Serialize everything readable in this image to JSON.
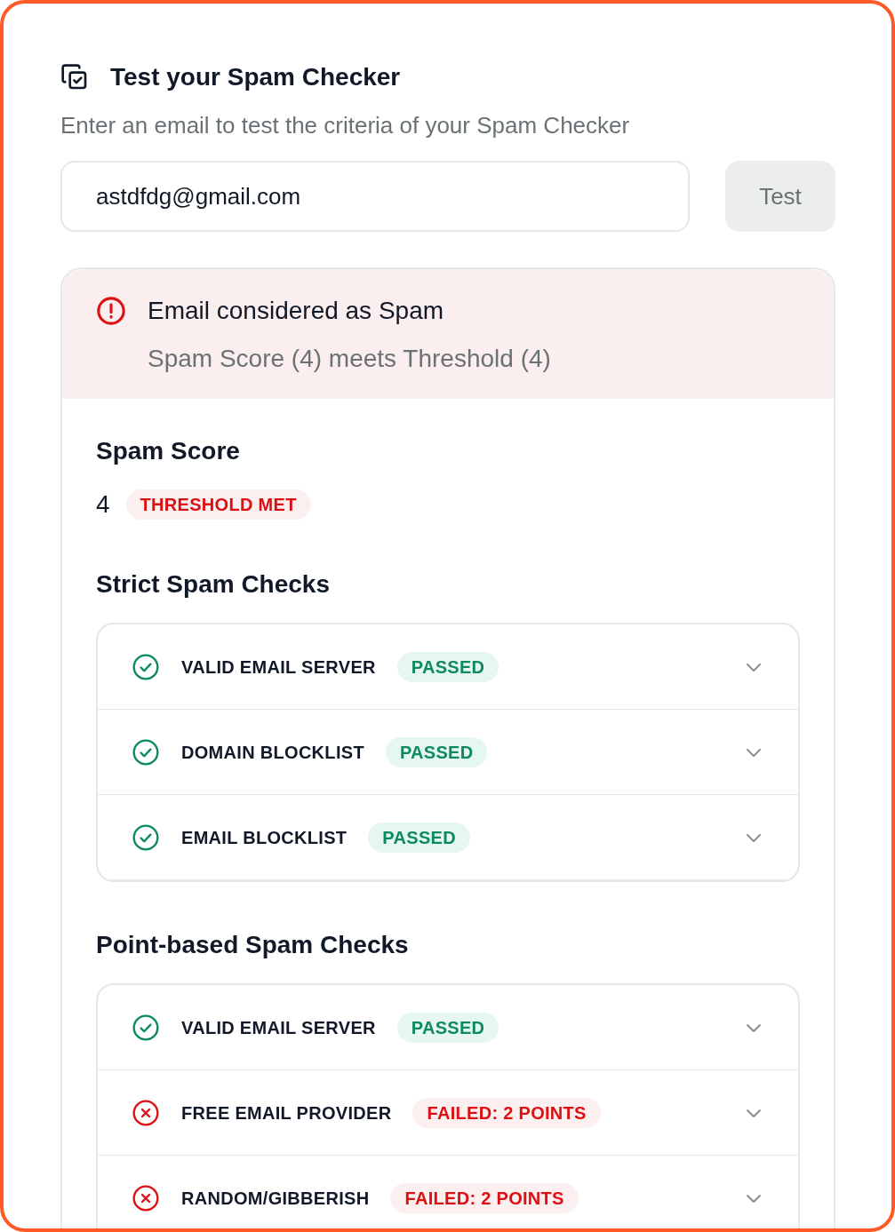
{
  "header": {
    "title": "Test your Spam Checker",
    "subtitle": "Enter an email to test the criteria of your Spam Checker"
  },
  "email_field": {
    "value": "astdfdg@gmail.com"
  },
  "test_button": {
    "label": "Test",
    "disabled": true
  },
  "result": {
    "kind": "spam",
    "title": "Email considered as Spam",
    "detail": "Spam Score (4) meets Threshold (4)"
  },
  "spam_score": {
    "heading": "Spam Score",
    "value": "4",
    "badge": "THRESHOLD MET"
  },
  "sections": [
    {
      "heading": "Strict Spam Checks",
      "checks": [
        {
          "label": "VALID EMAIL SERVER",
          "kind": "passed",
          "status": "PASSED"
        },
        {
          "label": "DOMAIN BLOCKLIST",
          "kind": "passed",
          "status": "PASSED"
        },
        {
          "label": "EMAIL BLOCKLIST",
          "kind": "passed",
          "status": "PASSED"
        }
      ]
    },
    {
      "heading": "Point-based Spam Checks",
      "checks": [
        {
          "label": "VALID EMAIL SERVER",
          "kind": "passed",
          "status": "PASSED"
        },
        {
          "label": "FREE EMAIL PROVIDER",
          "kind": "failed",
          "status": "FAILED: 2 POINTS"
        },
        {
          "label": "RANDOM/GIBBERISH",
          "kind": "failed",
          "status": "FAILED: 2 POINTS"
        }
      ]
    }
  ]
}
